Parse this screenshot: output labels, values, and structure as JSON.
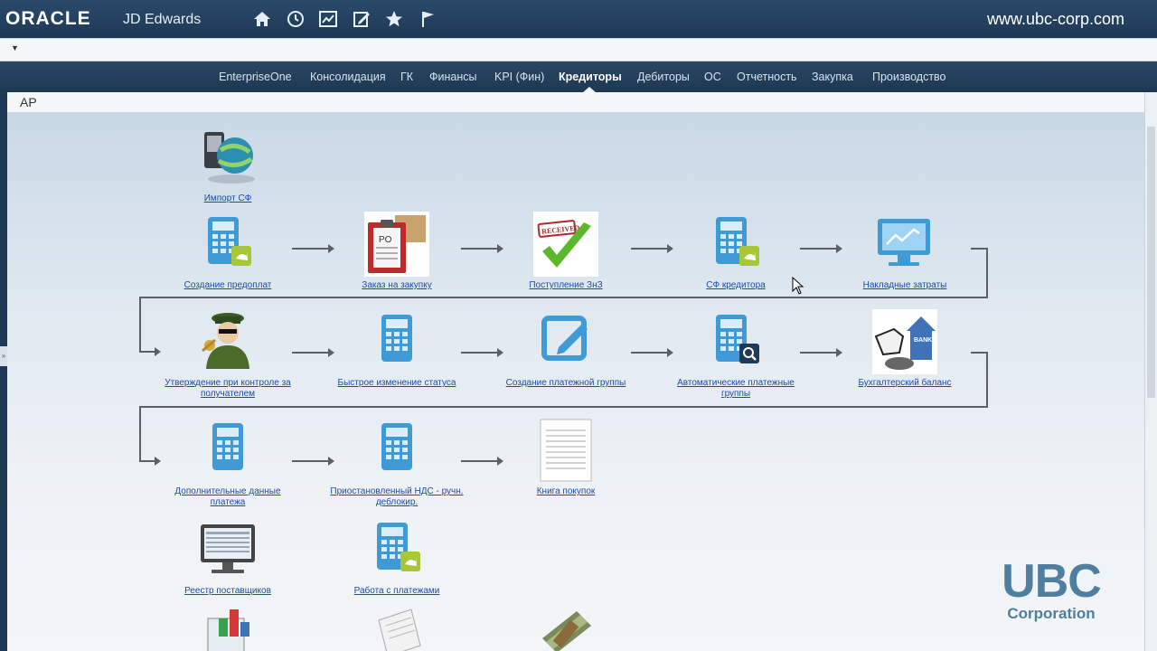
{
  "header": {
    "brand": "ORACLE",
    "product": "JD Edwards",
    "site": "www.ubc-corp.com",
    "icons": [
      "home-icon",
      "recent-icon",
      "chart-icon",
      "edit-icon",
      "favorites-icon",
      "flag-icon"
    ]
  },
  "tabs": [
    "EnterpriseOne",
    "Консолидация",
    "ГК",
    "Финансы",
    "KPI (Фин)",
    "Кредиторы",
    "Дебиторы",
    "ОС",
    "Отчетность",
    "Закупка",
    "Производство"
  ],
  "active_tab": "Кредиторы",
  "section": {
    "title": "AP"
  },
  "nodes": {
    "import": "Импорт СФ",
    "prepay": "Создание предоплат",
    "po": "Заказ на закупку",
    "receipt": "Поступление ЗнЗ",
    "sf": "СФ кредитора",
    "overhead": "Накладные затраты",
    "approve": "Утверждение при контроле за получателем",
    "status": "Быстрое изменение статуса",
    "paygroup": "Создание платежной группы",
    "autopay": "Автоматические платежные группы",
    "balance": "Бухгалтерский баланс",
    "addpay": "Дополнительные данные платежа",
    "vat": "Приостановленный НДС - ручн. деблокир.",
    "purchbook": "Книга покупок",
    "registry": "Реестр поставщиков",
    "payments": "Работа с платежами"
  },
  "icon_texts": {
    "po": "PO",
    "received": "RECEIVED",
    "bank": "BANK"
  },
  "logo": {
    "big": "UBC",
    "small": "Corporation"
  },
  "colors": {
    "header": "#1f3a56",
    "link": "#1a4ca8",
    "calc": "#3f9ad6",
    "accent": "#a8c63a",
    "logo": "#4f7fa0"
  }
}
